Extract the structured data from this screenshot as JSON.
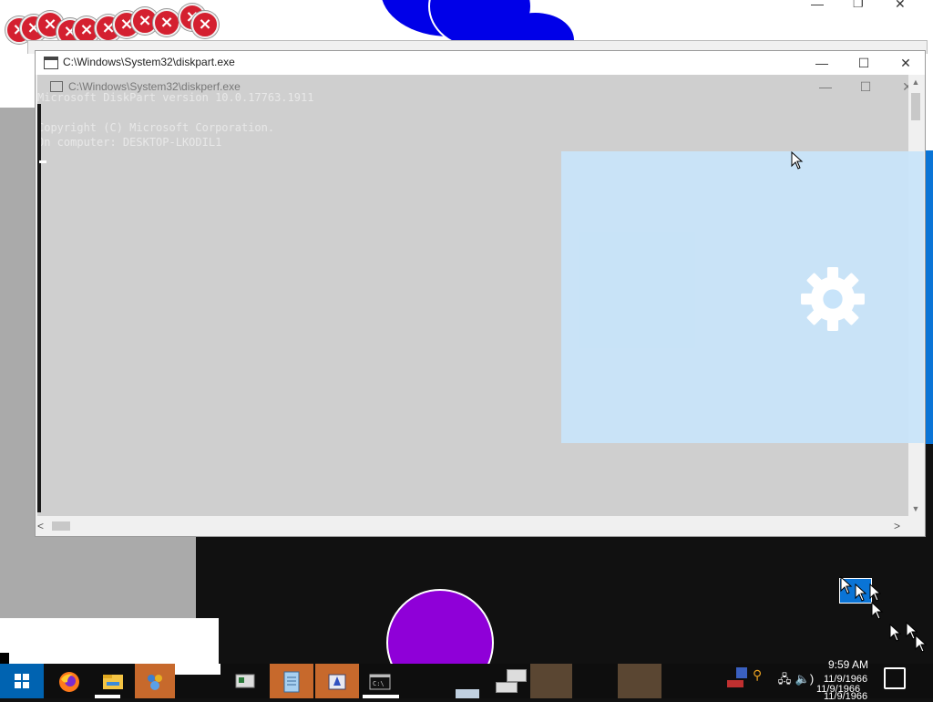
{
  "background": {
    "colors": {
      "desktop": "#111111",
      "blue_circles": "#0000e8",
      "purple_circle": "#8f00d8",
      "error_icon": "#d42030"
    },
    "error_icons_count": 10
  },
  "top_window_controls": {
    "minimize": "—",
    "maximize": "❐",
    "close": "✕"
  },
  "diskpart_window": {
    "title": "C:\\Windows\\System32\\diskpart.exe",
    "controls": {
      "minimize": "—",
      "maximize": "☐",
      "close": "✕"
    },
    "inner_title": "C:\\Windows\\System32\\diskperf.exe",
    "inner_controls": {
      "minimize": "—",
      "maximize": "☐",
      "close": "✕"
    },
    "console_lines": [
      "Microsoft DiskPart version 10.0.17763.1911",
      "",
      "Copyright (C) Microsoft Corporation.",
      "On computer: DESKTOP-LKODIL1"
    ],
    "scroll": {
      "up": "▲",
      "down": "▼",
      "left": "<",
      "right": ">"
    }
  },
  "settings_overlay": {
    "icon": "gear-icon",
    "color": "#c8e4fa"
  },
  "taskbar": {
    "start_icon": "windows-logo-icon",
    "pinned": [
      "firefox-icon",
      "file-explorer-icon",
      "network-app-icon",
      "window-app-icon",
      "notepad-icon",
      "installer-icon",
      "cmd-icon"
    ],
    "tray": {
      "time": "9:59 AM",
      "dates": [
        "11/9/1966",
        "11/9/1966",
        "11/9/1966"
      ],
      "icons": [
        "network-icon",
        "volume-icon",
        "notification-icon"
      ],
      "volume_glyph": "🔈)"
    }
  }
}
